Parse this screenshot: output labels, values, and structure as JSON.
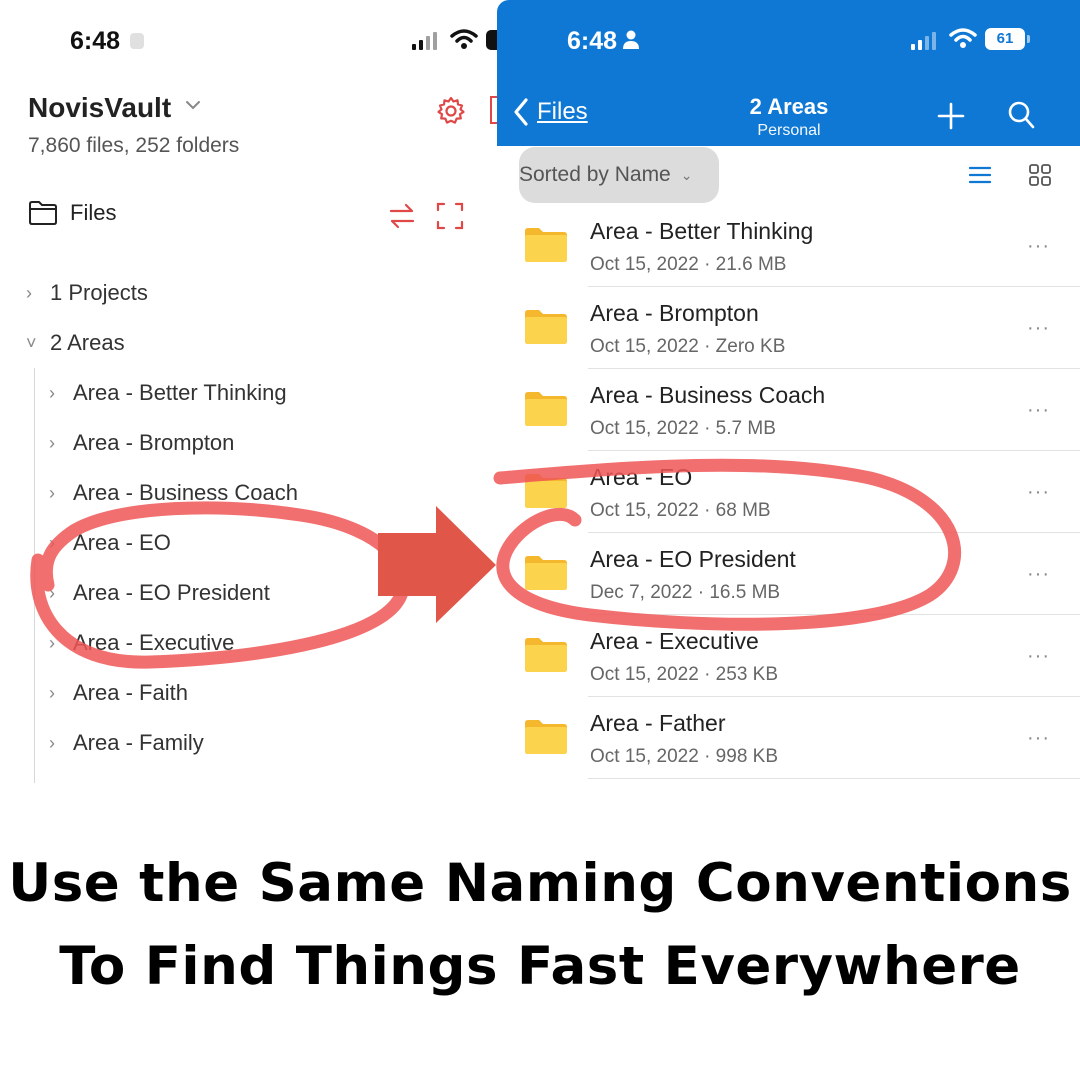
{
  "left_app": {
    "status_time": "6:48",
    "vault_name": "NovisVault",
    "vault_meta": "7,860 files, 252 folders",
    "files_label": "Files",
    "tree": [
      {
        "label": "1 Projects",
        "expanded": false,
        "level": 0
      },
      {
        "label": "2 Areas",
        "expanded": true,
        "level": 0
      },
      {
        "label": "Area - Better Thinking",
        "expanded": false,
        "level": 1
      },
      {
        "label": "Area - Brompton",
        "expanded": false,
        "level": 1
      },
      {
        "label": "Area - Business Coach",
        "expanded": false,
        "level": 1
      },
      {
        "label": "Area - EO",
        "expanded": false,
        "level": 1
      },
      {
        "label": "Area - EO President",
        "expanded": false,
        "level": 1
      },
      {
        "label": "Area - Executive",
        "expanded": false,
        "level": 1
      },
      {
        "label": "Area - Faith",
        "expanded": false,
        "level": 1
      },
      {
        "label": "Area - Family",
        "expanded": false,
        "level": 1
      }
    ],
    "accent_color": "#e04848",
    "icons": [
      "chevron-down-icon",
      "gear-icon",
      "folder-icon",
      "swap-icon",
      "expand-icon"
    ]
  },
  "right_app": {
    "status_time": "6:48",
    "battery": "61",
    "header_color": "#0f78d4",
    "back_label": "Files",
    "title": "2 Areas",
    "subtitle": "Personal",
    "sort_label": "Sorted by Name",
    "files": [
      {
        "name": "Area - Better Thinking",
        "meta": "Oct 15, 2022 · 21.6 MB"
      },
      {
        "name": "Area - Brompton",
        "meta": "Oct 15, 2022 · Zero KB"
      },
      {
        "name": "Area - Business Coach",
        "meta": "Oct 15, 2022 · 5.7 MB"
      },
      {
        "name": "Area - EO",
        "meta": "Oct 15, 2022 · 68 MB"
      },
      {
        "name": "Area - EO President",
        "meta": "Dec 7, 2022 · 16.5 MB"
      },
      {
        "name": "Area - Executive",
        "meta": "Oct 15, 2022 · 253 KB"
      },
      {
        "name": "Area - Father",
        "meta": "Oct 15, 2022 · 998 KB"
      }
    ],
    "more_glyph": "···",
    "folder_color": "#fcd34d",
    "icons": [
      "person-icon",
      "back-icon",
      "plus-icon",
      "search-icon",
      "list-view-icon",
      "grid-view-icon",
      "folder-icon",
      "more-icon"
    ]
  },
  "annotation": {
    "circle_color": "#f05656",
    "arrow_color": "#e0574a"
  },
  "caption": {
    "line1": "Use the Same Naming Conventions",
    "line2": "To Find Things Fast Everywhere"
  }
}
